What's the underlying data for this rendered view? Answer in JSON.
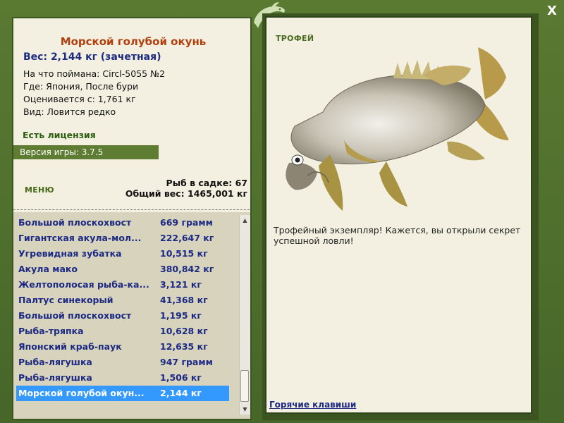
{
  "fish": {
    "title": "Морской голубой окунь",
    "weight": "Вес: 2,144 кг (зачетная)",
    "caught_with": "На что поймана: Circl-5055 №2",
    "where": "Где: Япония, После бури",
    "valued_from": "Оценивается с: 1,761 кг",
    "kind": "Вид: Ловится редко"
  },
  "license": "Есть лицензия",
  "version": "Версия игры: 3.7.5",
  "menu_label": "МЕНЮ",
  "stats": {
    "count": "Рыб в садке: 67",
    "total": "Общий вес: 1465,001 кг"
  },
  "catch_list": [
    {
      "name": "Большой плоскохвост",
      "weight": "669 грамм"
    },
    {
      "name": "Гигантская акула-мол...",
      "weight": "222,647 кг"
    },
    {
      "name": "Угревидная зубатка",
      "weight": "10,515 кг"
    },
    {
      "name": "Акула мако",
      "weight": "380,842 кг"
    },
    {
      "name": "Желтополосая рыба-ка...",
      "weight": "3,121 кг"
    },
    {
      "name": "Палтус синекорый",
      "weight": "41,368 кг"
    },
    {
      "name": "Большой плоскохвост",
      "weight": "1,195 кг"
    },
    {
      "name": "Рыба-тряпка",
      "weight": "10,628 кг"
    },
    {
      "name": "Японский краб-паук",
      "weight": "12,635 кг"
    },
    {
      "name": "Рыба-лягушка",
      "weight": "947 грамм"
    },
    {
      "name": "Рыба-лягушка",
      "weight": "1,506 кг"
    },
    {
      "name": "Морской голубой окун...",
      "weight": "2,144 кг"
    }
  ],
  "selected_index": 11,
  "trophy_label": "ТРОФЕЙ",
  "description": "Трофейный экземпляр! Кажется, вы открыли секрет успешной ловли!",
  "hotkeys": "Горячие клавиши",
  "close_label": "X",
  "colors": {
    "frame": "#4e6b2a",
    "panel": "#f3f0e1",
    "title": "#b1400f",
    "link": "#1c2a84",
    "selection": "#3399ff"
  }
}
